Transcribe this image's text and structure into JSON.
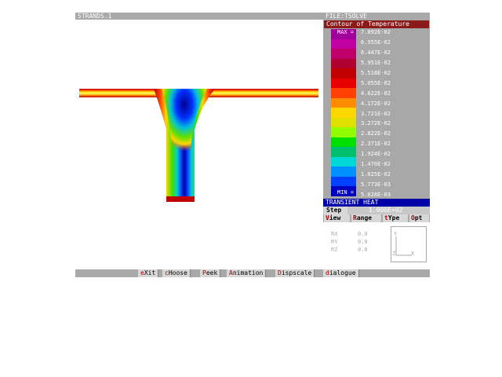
{
  "window": {
    "title_left": "STRANDS.1",
    "title_right": "FILE:TSOLVE"
  },
  "legend": {
    "title": "Contour of Temperature",
    "max_label": "MAX =",
    "min_label": "MIN =",
    "values": [
      "7.092E-02",
      "6.955E-02",
      "6.447E-02",
      "5.951E-02",
      "5.518E-02",
      "5.055E-02",
      "4.622E-02",
      "4.172E-02",
      "3.721E-02",
      "3.272E-02",
      "2.822E-02",
      "2.371E-02",
      "1.924E-02",
      "1.476E-02",
      "1.025E-02",
      "5.773E-03",
      "5.628E-03"
    ],
    "colors": [
      "#a0009a",
      "#c000a0",
      "#c0006a",
      "#b00030",
      "#c00000",
      "#e80000",
      "#ff4000",
      "#ff8c00",
      "#ffd700",
      "#e0e000",
      "#90ff00",
      "#00e000",
      "#00c070",
      "#00d8d8",
      "#0090ff",
      "#0040ff",
      "#0000c0"
    ]
  },
  "mode_bar": "TRANSIENT HEAT",
  "step": {
    "label": "Step",
    "value": "1.000E+02"
  },
  "tabs": [
    {
      "hot": "V",
      "rest": "iew"
    },
    {
      "hot": "R",
      "rest": "ange"
    },
    {
      "hot": "t",
      "rest": "Ype"
    },
    {
      "hot": "O",
      "rest": "pt"
    }
  ],
  "rotation": {
    "rx_label": "RX",
    "ry_label": "RY",
    "rz_label": "RZ",
    "rx": "0.0",
    "ry": "0.0",
    "rz": "0.0"
  },
  "axes": {
    "y": "Y",
    "x": "X",
    "z": "Z"
  },
  "menu": [
    {
      "hot": "e",
      "rest": "Xit"
    },
    {
      "hot": "c",
      "rest": "Hoose"
    },
    {
      "hot": "P",
      "rest": "eek"
    },
    {
      "hot": "A",
      "rest": "nimation"
    },
    {
      "hot": "D",
      "rest": "ispscale"
    },
    {
      "hot": "d",
      "rest": "ialogue"
    }
  ]
}
